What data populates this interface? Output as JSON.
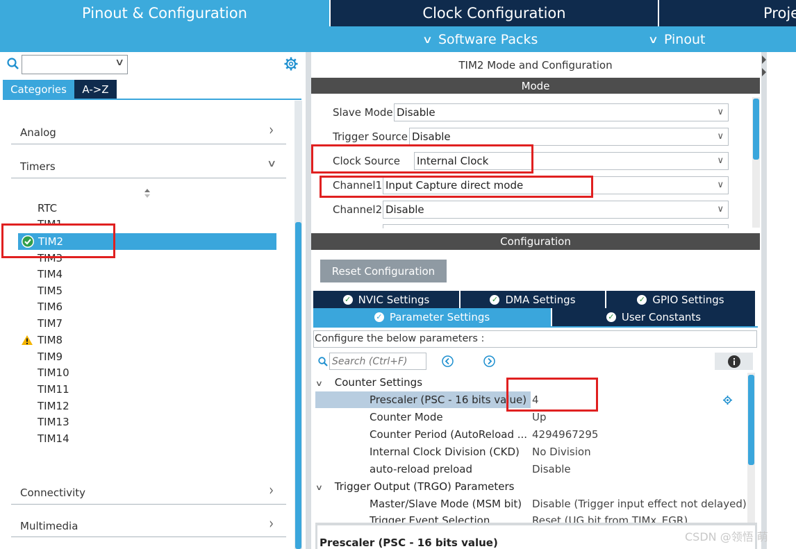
{
  "header": {
    "tabs": [
      "Pinout & Configuration",
      "Clock Configuration",
      "Proje"
    ],
    "menus": [
      "Software Packs",
      "Pinout"
    ]
  },
  "left": {
    "search_value": "",
    "tabs": [
      "Categories",
      "A->Z"
    ],
    "categories": {
      "analog": "Analog",
      "timers": "Timers",
      "connectivity": "Connectivity",
      "multimedia": "Multimedia"
    },
    "timers": [
      "RTC",
      "TIM1",
      "TIM2",
      "TIM3",
      "TIM4",
      "TIM5",
      "TIM6",
      "TIM7",
      "TIM8",
      "TIM9",
      "TIM10",
      "TIM11",
      "TIM12",
      "TIM13",
      "TIM14"
    ],
    "selected_timer": "TIM2",
    "warning_timer": "TIM8"
  },
  "right": {
    "title": "TIM2 Mode and Configuration",
    "mode_header": "Mode",
    "mode_rows": [
      {
        "label": "Slave Mode",
        "value": "Disable"
      },
      {
        "label": "Trigger Source",
        "value": "Disable"
      },
      {
        "label": "Clock Source",
        "value": "Internal Clock"
      },
      {
        "label": "Channel1",
        "value": "Input Capture direct mode"
      },
      {
        "label": "Channel2",
        "value": "Disable"
      }
    ],
    "config_header": "Configuration",
    "reset_button": "Reset Configuration",
    "tabs_row1": [
      "NVIC Settings",
      "DMA Settings",
      "GPIO Settings"
    ],
    "tabs_row2": [
      "Parameter Settings",
      "User Constants"
    ],
    "instruction": "Configure the below parameters :",
    "search_placeholder": "Search (Ctrl+F)",
    "groups": {
      "counter": "Counter Settings",
      "trigger": "Trigger Output (TRGO) Parameters"
    },
    "params": [
      {
        "name": "Prescaler (PSC - 16 bits value)",
        "value": "4"
      },
      {
        "name": "Counter Mode",
        "value": "Up"
      },
      {
        "name": "Counter Period (AutoReload ...",
        "value": "4294967295"
      },
      {
        "name": "Internal Clock Division (CKD)",
        "value": "No Division"
      },
      {
        "name": "auto-reload preload",
        "value": "Disable"
      },
      {
        "name": "Master/Slave Mode (MSM bit)",
        "value": "Disable (Trigger input effect not delayed)"
      },
      {
        "name": "Trigger Event Selection",
        "value": "Reset (UG bit from TIMx_EGR)"
      }
    ],
    "description_title": "Prescaler (PSC - 16 bits value)"
  },
  "watermark": "CSDN @领悟 萌",
  "colors": {
    "header_blue": "#3caadc",
    "header_dark": "#0f2b4d",
    "selected_blue": "#3aa6dc",
    "highlight_red": "#e02020",
    "dark_bar": "#4d4d4d"
  }
}
